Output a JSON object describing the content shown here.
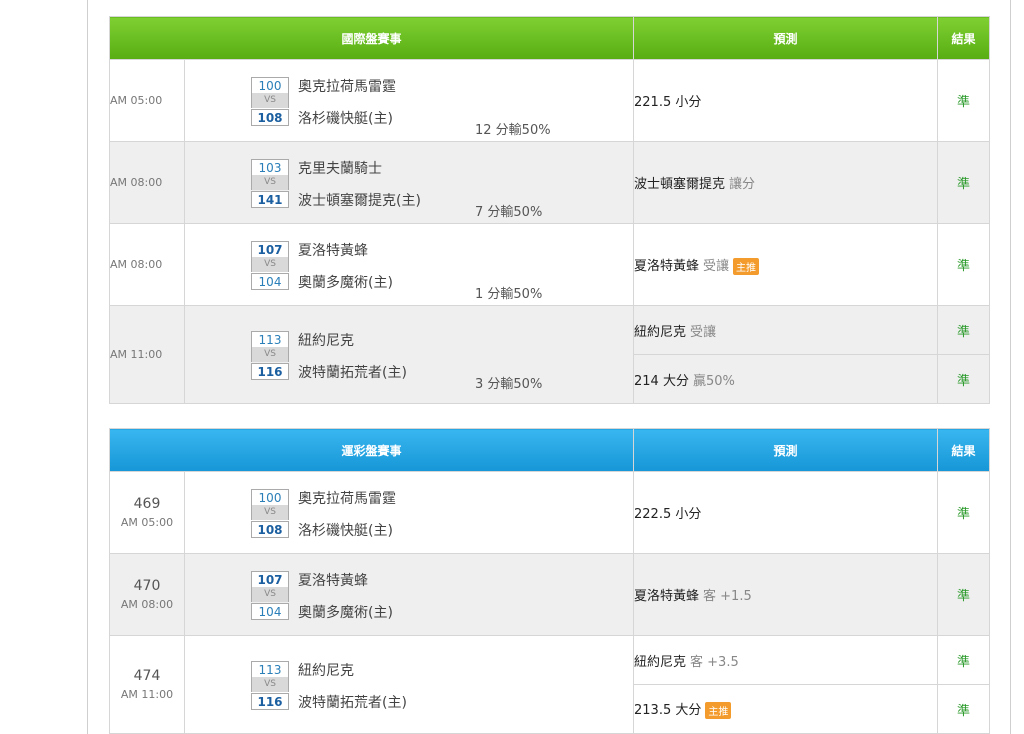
{
  "tables": [
    {
      "header": {
        "match": "國際盤賽事",
        "prediction": "預測",
        "result": "結果"
      },
      "games": [
        {
          "time": "AM 05:00",
          "home_score": "100",
          "away_score": "108",
          "team1": "奧克拉荷馬雷霆",
          "team2": "洛杉磯快艇(主)",
          "note": "12 分輸50%",
          "predictions": [
            {
              "main": "221.5 小分",
              "sub": "",
              "badge": "",
              "result": "準"
            }
          ]
        },
        {
          "time": "AM 08:00",
          "home_score": "103",
          "away_score": "141",
          "team1": "克里夫蘭騎士",
          "team2": "波士頓塞爾提克(主)",
          "note": "7 分輸50%",
          "predictions": [
            {
              "main": "波士頓塞爾提克",
              "sub": "讓分",
              "badge": "",
              "result": "準"
            }
          ]
        },
        {
          "time": "AM 08:00",
          "home_score": "107",
          "away_score": "104",
          "team1": "夏洛特黃蜂",
          "team2": "奧蘭多魔術(主)",
          "note": "1 分輸50%",
          "predictions": [
            {
              "main": "夏洛特黃蜂",
              "sub": "受讓",
              "badge": "主推",
              "result": "準"
            }
          ]
        },
        {
          "time": "AM 11:00",
          "home_score": "113",
          "away_score": "116",
          "team1": "紐約尼克",
          "team2": "波特蘭拓荒者(主)",
          "note": "3 分輸50%",
          "predictions": [
            {
              "main": "紐約尼克",
              "sub": "受讓",
              "badge": "",
              "result": "準"
            },
            {
              "main": "214 大分",
              "sub": "贏50%",
              "badge": "",
              "result": "準"
            }
          ]
        }
      ]
    },
    {
      "header": {
        "match": "運彩盤賽事",
        "prediction": "預測",
        "result": "結果"
      },
      "games": [
        {
          "number": "469",
          "time": "AM 05:00",
          "home_score": "100",
          "away_score": "108",
          "team1": "奧克拉荷馬雷霆",
          "team2": "洛杉磯快艇(主)",
          "note": "",
          "predictions": [
            {
              "main": "222.5 小分",
              "sub": "",
              "badge": "",
              "result": "準"
            }
          ]
        },
        {
          "number": "470",
          "time": "AM 08:00",
          "home_score": "107",
          "away_score": "104",
          "team1": "夏洛特黃蜂",
          "team2": "奧蘭多魔術(主)",
          "note": "",
          "predictions": [
            {
              "main": "夏洛特黃蜂",
              "sub": "客 +1.5",
              "badge": "",
              "result": "準"
            }
          ]
        },
        {
          "number": "474",
          "time": "AM 11:00",
          "home_score": "113",
          "away_score": "116",
          "team1": "紐約尼克",
          "team2": "波特蘭拓荒者(主)",
          "note": "",
          "predictions": [
            {
              "main": "紐約尼克",
              "sub": "客 +3.5",
              "badge": "",
              "result": "準"
            },
            {
              "main": "213.5 大分",
              "sub": "",
              "badge": "主推",
              "result": "準"
            }
          ]
        }
      ]
    }
  ],
  "colors": {
    "green_header": "#66bb22",
    "blue_header": "#23a5e6",
    "result_green": "#2a9a2a",
    "badge_orange": "#f39c2d"
  }
}
